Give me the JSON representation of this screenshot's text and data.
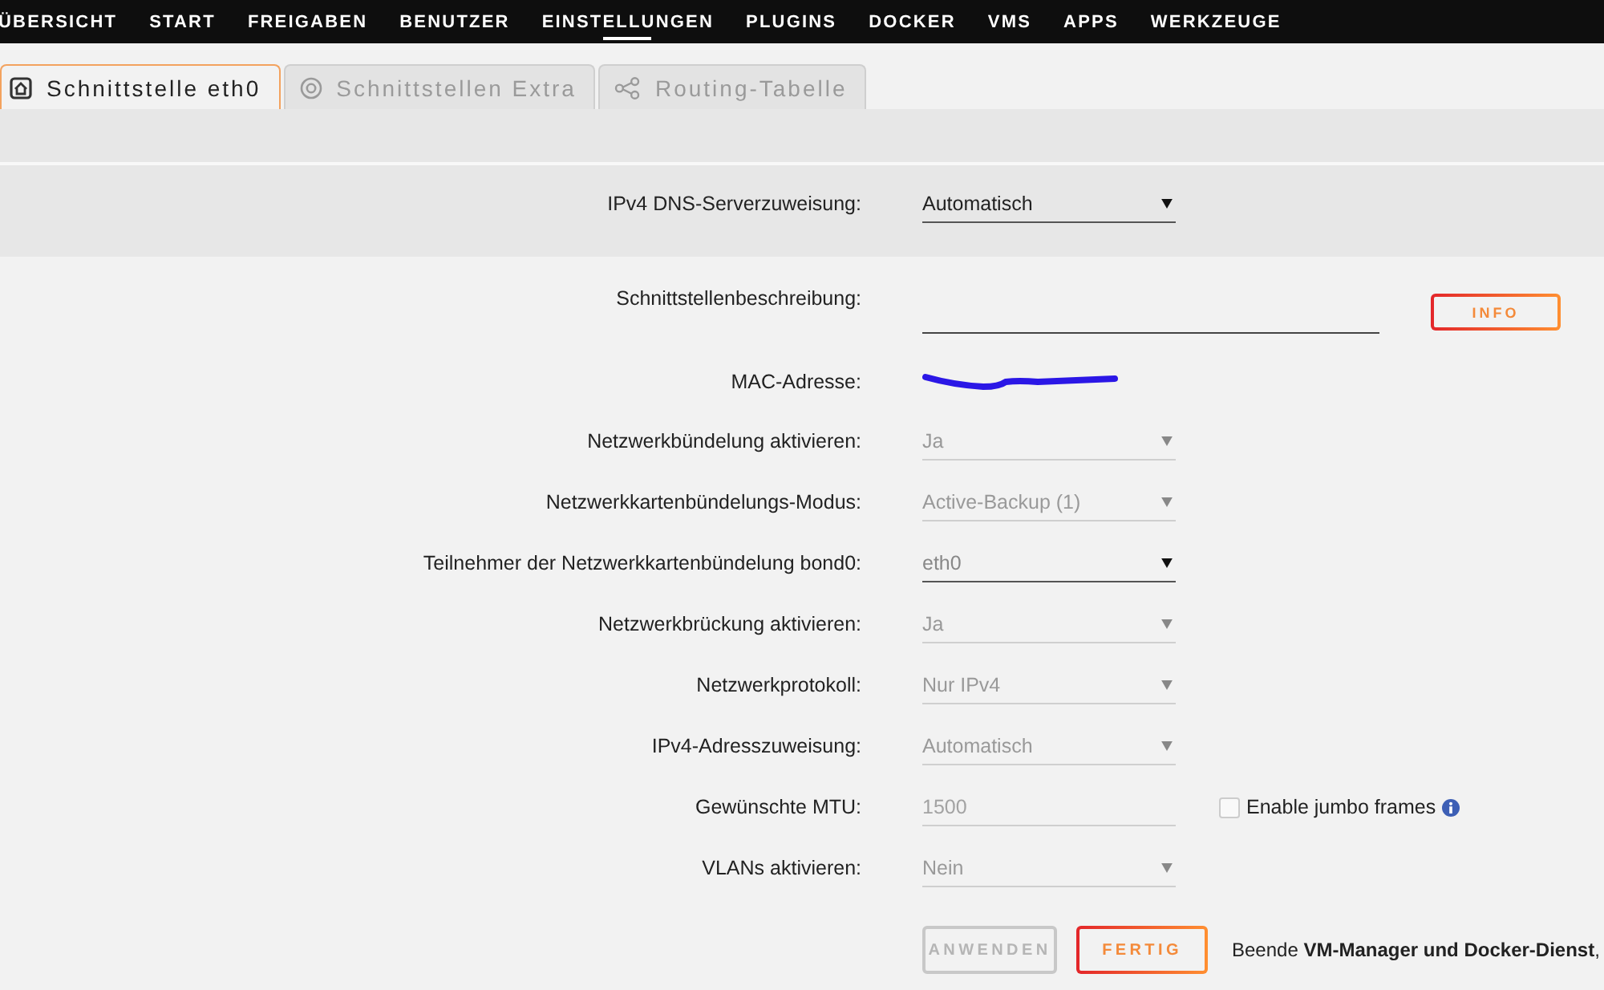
{
  "nav": {
    "items": [
      {
        "label": "ÜBERSICHT",
        "selected": false
      },
      {
        "label": "START",
        "selected": false
      },
      {
        "label": "FREIGABEN",
        "selected": false
      },
      {
        "label": "BENUTZER",
        "selected": false
      },
      {
        "label": "EINSTELLUNGEN",
        "selected": true
      },
      {
        "label": "PLUGINS",
        "selected": false
      },
      {
        "label": "DOCKER",
        "selected": false
      },
      {
        "label": "VMS",
        "selected": false
      },
      {
        "label": "APPS",
        "selected": false
      },
      {
        "label": "WERKZEUGE",
        "selected": false
      }
    ]
  },
  "tabs": [
    {
      "label": "Schnittstelle eth0",
      "selected": true
    },
    {
      "label": "Schnittstellen Extra",
      "selected": false
    },
    {
      "label": "Routing-Tabelle",
      "selected": false
    }
  ],
  "sections": [
    {
      "shaded": true,
      "rows": [
        {
          "label": "IPv4 DNS-Serverzuweisung:",
          "kind": "select",
          "value": "Automatisch",
          "disabled": false
        }
      ]
    },
    {
      "shaded": false,
      "rows": [
        {
          "label": "Schnittstellenbeschreibung:",
          "kind": "text",
          "disabled": false,
          "button": "INFO"
        },
        {
          "label": "MAC-Adresse:",
          "kind": "static",
          "redacted": true
        },
        {
          "label": "Netzwerkbündelung aktivieren:",
          "kind": "select",
          "value": "Ja",
          "disabled": true
        },
        {
          "label": "Netzwerkkartenbündelungs-Modus:",
          "kind": "select",
          "value": "Active-Backup (1)",
          "disabled": true
        },
        {
          "label": "Teilnehmer der Netzwerkkartenbündelung bond0:",
          "kind": "multiselect",
          "value": "eth0",
          "disabled": false
        },
        {
          "label": "Netzwerkbrückung aktivieren:",
          "kind": "select",
          "value": "Ja",
          "disabled": true
        },
        {
          "label": "Netzwerkprotokoll:",
          "kind": "select",
          "value": "Nur IPv4",
          "disabled": true
        },
        {
          "label": "IPv4-Adresszuweisung:",
          "kind": "select",
          "value": "Automatisch",
          "disabled": true
        },
        {
          "label": "Gewünschte MTU:",
          "kind": "input",
          "placeholder": "1500",
          "disabled": true,
          "checkbox": {
            "label": "Enable jumbo frames",
            "checked": false
          }
        },
        {
          "label": "VLANs aktivieren:",
          "kind": "select",
          "value": "Nein",
          "disabled": true
        }
      ]
    }
  ],
  "actions": {
    "buttons": [
      {
        "label": "ANWENDEN",
        "disabled": true
      },
      {
        "label": "FERTIG",
        "disabled": false
      }
    ],
    "note": "Beende **VM-Manager und Docker-Dienst**,"
  }
}
